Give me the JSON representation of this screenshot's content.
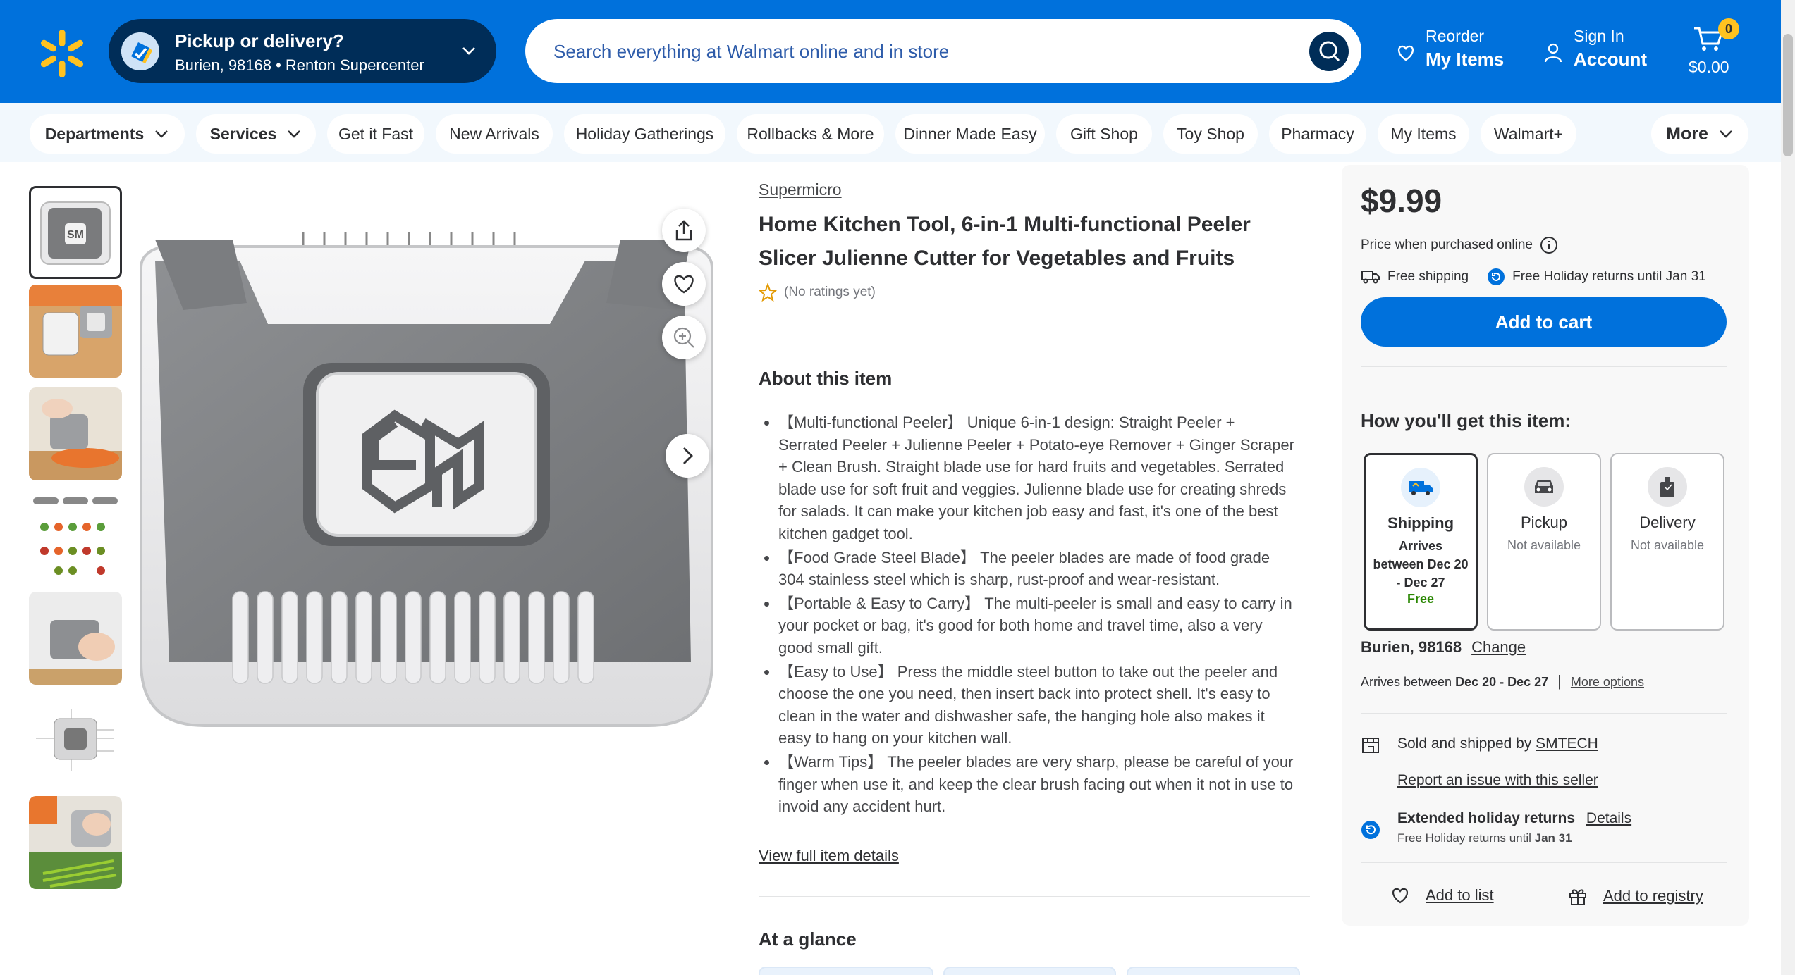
{
  "header": {
    "pickup_title": "Pickup or delivery?",
    "pickup_sub": "Burien, 98168 • Renton Supercenter",
    "search_placeholder": "Search everything at Walmart online and in store",
    "reorder_l1": "Reorder",
    "reorder_l2": "My Items",
    "signin_l1": "Sign In",
    "signin_l2": "Account",
    "cart_count": "0",
    "cart_total": "$0.00",
    "brand_color": "#0071dc",
    "spark_color": "#ffc220"
  },
  "subnav": {
    "departments": "Departments",
    "services": "Services",
    "links": [
      "Get it Fast",
      "New Arrivals",
      "Holiday Gatherings",
      "Rollbacks & More",
      "Dinner Made Easy",
      "Gift Shop",
      "Toy Shop",
      "Pharmacy",
      "My Items",
      "Walmart+"
    ],
    "more": "More"
  },
  "product": {
    "brand": "Supermicro",
    "title": "Home Kitchen Tool, 6-in-1 Multi-functional Peeler Slicer Julienne Cutter for Vegetables and Fruits",
    "rating_text": "(No ratings yet)",
    "about_heading": "About this item",
    "about_items": [
      "【Multi-functional Peeler】 Unique 6-in-1 design: Straight Peeler + Serrated Peeler + Julienne Peeler + Potato-eye Remover + Ginger Scraper + Clean Brush. Straight blade use for hard fruits and vegetables. Serrated blade use for soft fruit and veggies. Julienne blade use for creating shreds for salads. It can make your kitchen job easy and fast, it's one of the best kitchen gadget tool.",
      "【Food Grade Steel Blade】 The peeler blades are made of food grade 304 stainless steel which is sharp, rust-proof and wear-resistant.",
      "【Portable & Easy to Carry】 The multi-peeler is small and easy to carry in your pocket or bag, it's good for both home and travel time, also a very good small gift.",
      "【Easy to Use】 Press the middle steel button to take out the peeler and choose the one you need, then insert back into protect shell. It's easy to clean in the water and dishwasher safe, the hanging hole also makes it easy to hang on your kitchen wall.",
      "【Warm Tips】 The peeler blades are very sharp, please be careful of your finger when use it, and keep the clear brush facing out when it not in use to invoid any accident hurt."
    ],
    "view_full": "View full item details",
    "glance_heading": "At a glance"
  },
  "buybox": {
    "price": "$9.99",
    "price_note": "Price when purchased online",
    "free_shipping": "Free shipping",
    "free_returns": "Free Holiday returns until Jan 31",
    "add_to_cart": "Add to cart",
    "how_get": "How you'll get this item:",
    "options": [
      {
        "name": "Shipping",
        "desc": "Arrives between Dec 20 - Dec 27",
        "extra": "Free"
      },
      {
        "name": "Pickup",
        "desc": "Not available",
        "extra": ""
      },
      {
        "name": "Delivery",
        "desc": "Not available",
        "extra": ""
      }
    ],
    "location": "Burien, 98168",
    "change": "Change",
    "arrives_prefix": "Arrives between ",
    "arrives_dates": "Dec 20 - Dec 27",
    "more_options": "More options",
    "sold_by_prefix": "Sold and shipped by ",
    "seller": "SMTECH",
    "report": "Report an issue with this seller",
    "ext_returns": "Extended holiday returns",
    "details": "Details",
    "ret_sub_prefix": "Free Holiday returns until ",
    "ret_sub_date": "Jan 31",
    "add_to_list": "Add to list",
    "add_to_registry": "Add to registry"
  }
}
